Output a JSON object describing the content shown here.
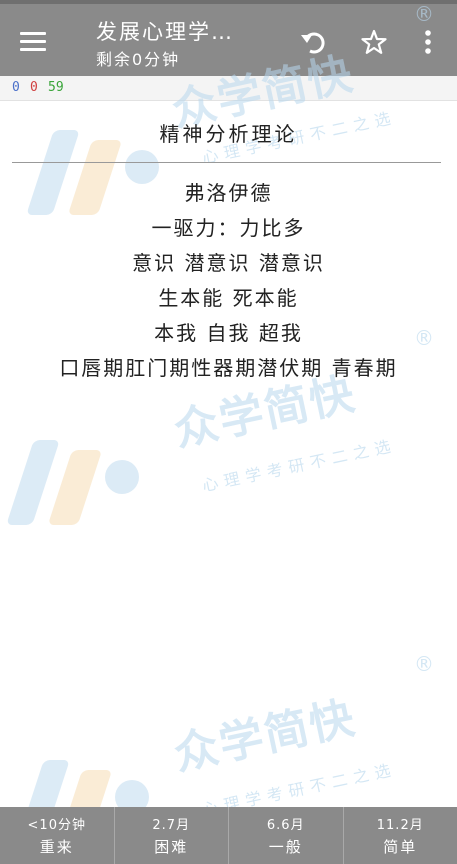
{
  "header": {
    "title": "发展心理学…",
    "subtitle": "剩余0分钟"
  },
  "icons": {
    "menu": "menu-icon",
    "undo": "undo-icon",
    "star": "star-outline-icon",
    "more": "more-vertical-icon"
  },
  "score": {
    "blue": "0",
    "red": "0",
    "green": "59"
  },
  "card": {
    "heading": "精神分析理论",
    "lines": [
      "弗洛伊德",
      "一驱力：力比多",
      "意识 潜意识 潜意识",
      "生本能 死本能",
      "本我 自我 超我",
      "口唇期肛门期性器期潜伏期 青春期"
    ]
  },
  "watermark": {
    "brand": "众学简快",
    "slogan": "心理学考研不二之选",
    "mark": "®"
  },
  "rating": [
    {
      "time": "<10分钟",
      "label": "重来"
    },
    {
      "time": "2.7月",
      "label": "困难"
    },
    {
      "time": "6.6月",
      "label": "一般"
    },
    {
      "time": "11.2月",
      "label": "简单"
    }
  ],
  "colors": {
    "bar": "#8a8a8a",
    "score_blue": "#4a6fc9",
    "score_red": "#d04040",
    "score_green": "#3aa53a",
    "watermark": "#b9d8ee"
  }
}
